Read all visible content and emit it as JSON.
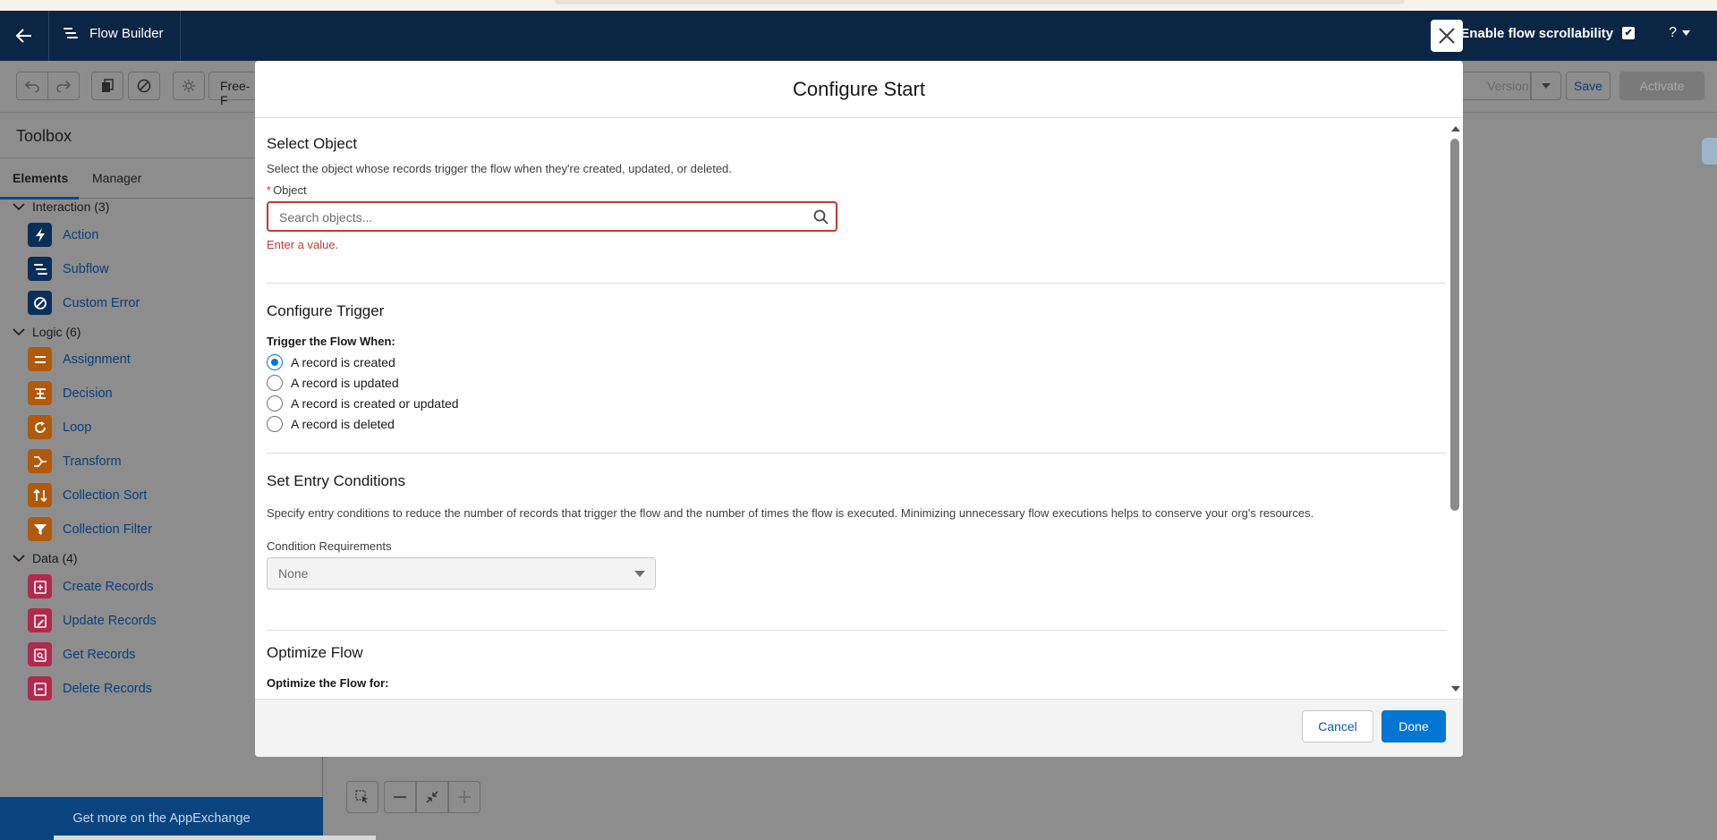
{
  "header": {
    "app_title": "Flow Builder",
    "scroll_toggle_label": "Enable flow scrollability",
    "help_label": "?"
  },
  "toolbar": {
    "layout_select_label": "Free-F",
    "version_label": "Version",
    "save_label": "Save",
    "activate_label": "Activate"
  },
  "sidebar": {
    "title": "Toolbox",
    "tabs": [
      "Elements",
      "Manager"
    ],
    "groups": [
      {
        "label": "Interaction (3)",
        "items": [
          "Action",
          "Subflow",
          "Custom Error"
        ]
      },
      {
        "label": "Logic (6)",
        "items": [
          "Assignment",
          "Decision",
          "Loop",
          "Transform",
          "Collection Sort",
          "Collection Filter"
        ]
      },
      {
        "label": "Data (4)",
        "items": [
          "Create Records",
          "Update Records",
          "Get Records",
          "Delete Records"
        ]
      }
    ],
    "appexchange_label": "Get more on the AppExchange"
  },
  "modal": {
    "title": "Configure Start",
    "select_object": {
      "title": "Select Object",
      "description": "Select the object whose records trigger the flow when they're created, updated, or deleted.",
      "field_label": "Object",
      "required_marker": "*",
      "placeholder": "Search objects...",
      "value": "",
      "error": "Enter a value."
    },
    "configure_trigger": {
      "title": "Configure Trigger",
      "label": "Trigger the Flow When:",
      "options": [
        "A record is created",
        "A record is updated",
        "A record is created or updated",
        "A record is deleted"
      ],
      "selected": "A record is created"
    },
    "entry_conditions": {
      "title": "Set Entry Conditions",
      "description": "Specify entry conditions to reduce the number of records that trigger the flow and the number of times the flow is executed. Minimizing unnecessary flow executions helps to conserve your org's resources.",
      "requirements_label": "Condition Requirements",
      "requirements_value": "None"
    },
    "optimize": {
      "title": "Optimize Flow",
      "label": "Optimize the Flow for:"
    },
    "cancel_label": "Cancel",
    "done_label": "Done"
  },
  "colors": {
    "header_bg": "#0b2545",
    "brand_blue": "#0176d3",
    "error_red": "#c23934",
    "overlay_gray": "#8d8d8d"
  }
}
